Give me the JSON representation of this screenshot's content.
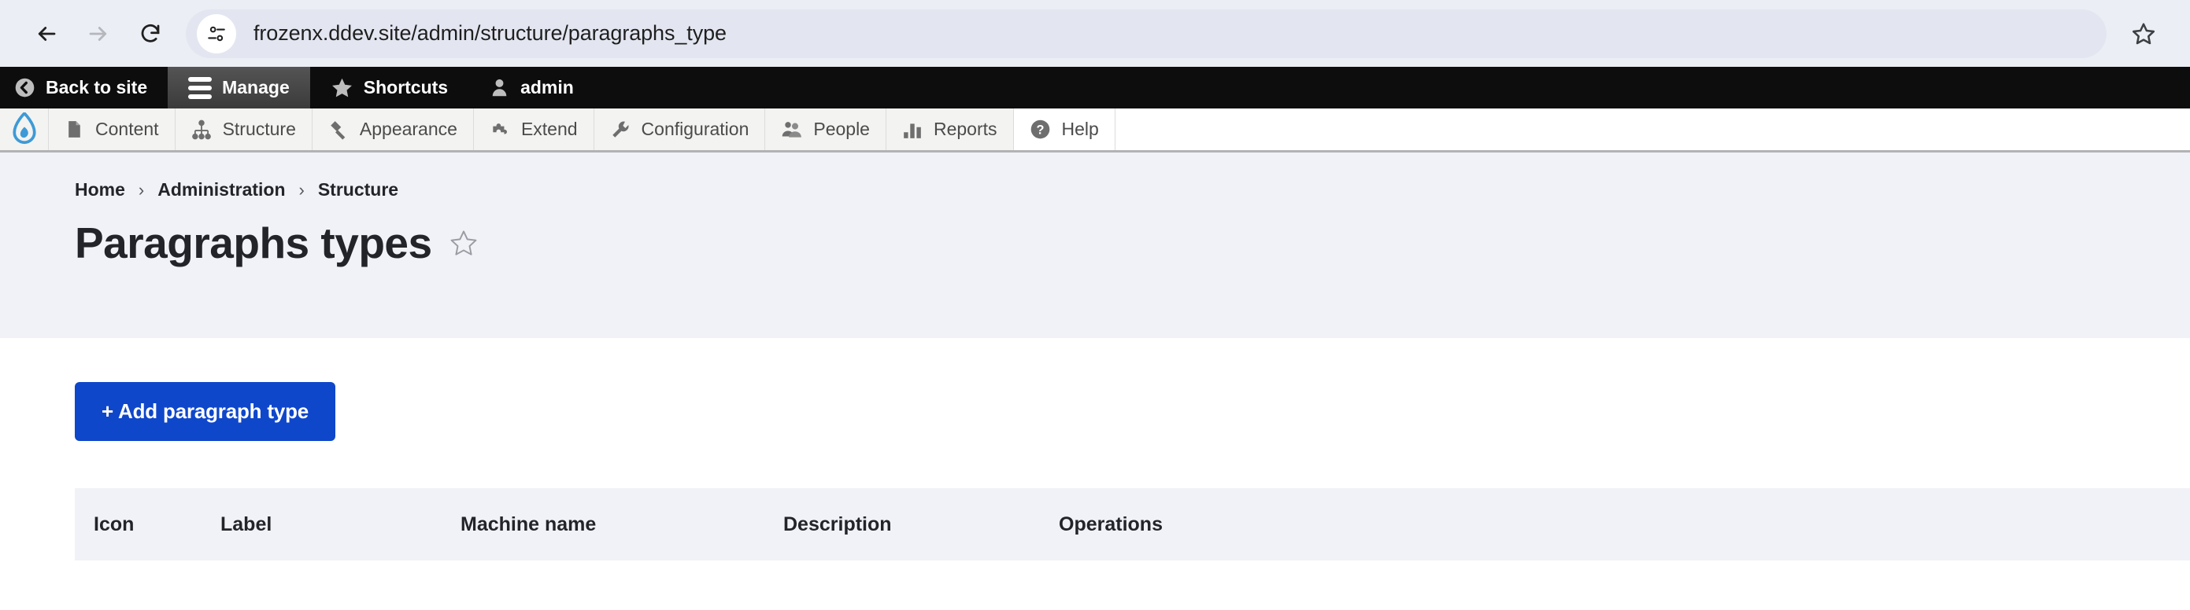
{
  "browser": {
    "back_icon": "arrow-left-icon",
    "forward_icon": "arrow-right-icon",
    "reload_icon": "reload-icon",
    "site_info_icon": "site-settings-icon",
    "url": "frozenx.ddev.site/admin/structure/paragraphs_type",
    "bookmark_icon": "bookmark-star-icon"
  },
  "admin_toolbar": {
    "items": [
      {
        "label": "Back to site",
        "icon": "back-circle-icon",
        "active": false
      },
      {
        "label": "Manage",
        "icon": "hamburger-icon",
        "active": true
      },
      {
        "label": "Shortcuts",
        "icon": "star-icon",
        "active": false
      },
      {
        "label": "admin",
        "icon": "user-icon",
        "active": false
      }
    ]
  },
  "menu_bar": {
    "logo_icon": "drupal-droplet-icon",
    "items": [
      {
        "label": "Content",
        "icon": "document-icon",
        "active": false
      },
      {
        "label": "Structure",
        "icon": "sitemap-icon",
        "active": false
      },
      {
        "label": "Appearance",
        "icon": "paintbrush-icon",
        "active": false
      },
      {
        "label": "Extend",
        "icon": "puzzle-piece-icon",
        "active": false
      },
      {
        "label": "Configuration",
        "icon": "wrench-icon",
        "active": false
      },
      {
        "label": "People",
        "icon": "people-icon",
        "active": false
      },
      {
        "label": "Reports",
        "icon": "bar-chart-icon",
        "active": false
      },
      {
        "label": "Help",
        "icon": "question-circle-icon",
        "active": true
      }
    ]
  },
  "breadcrumb": {
    "items": [
      "Home",
      "Administration",
      "Structure"
    ],
    "separator": "›"
  },
  "page": {
    "title": "Paragraphs types",
    "star_icon": "star-outline-icon"
  },
  "actions": {
    "add_button_label": "+ Add paragraph type"
  },
  "table": {
    "columns": [
      "Icon",
      "Label",
      "Machine name",
      "Description",
      "Operations"
    ],
    "rows": []
  },
  "colors": {
    "accent_blue": "#0f47ca",
    "toolbar_black": "#0d0d0d",
    "header_bg": "#f0f2f7",
    "drupal_blue": "#3e9ad6"
  }
}
